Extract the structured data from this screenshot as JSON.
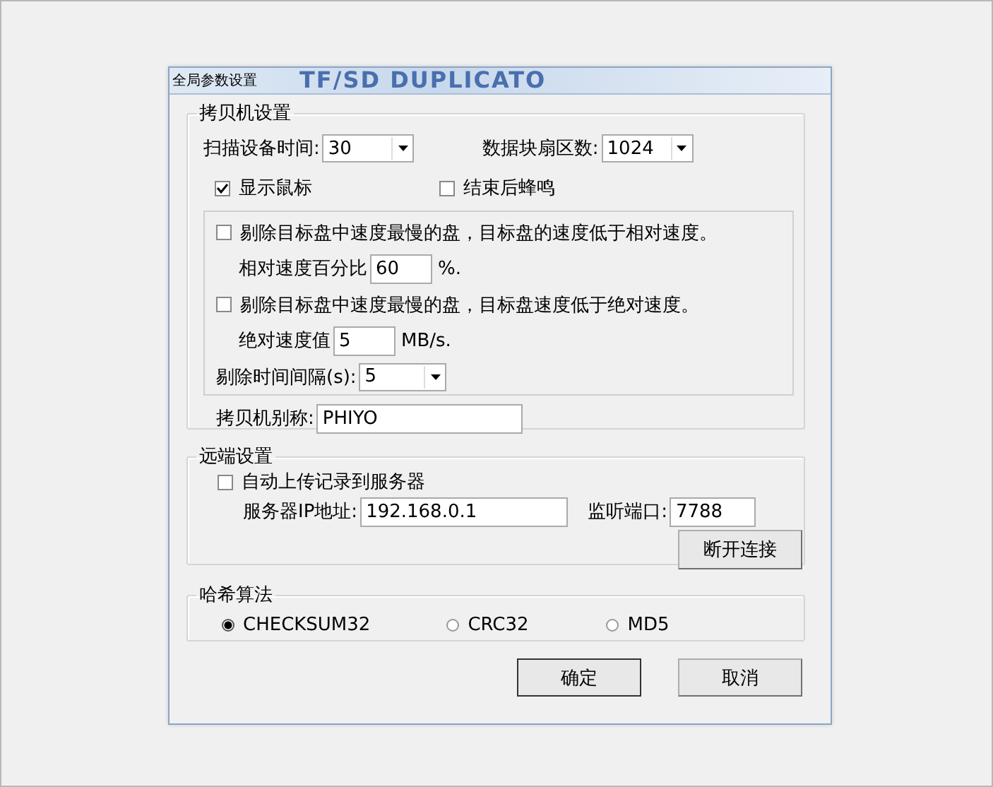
{
  "window": {
    "title": "全局参数设置",
    "banner": "TF/SD DUPLICATO"
  },
  "copier": {
    "title": "拷贝机设置",
    "combos": [
      {
        "label": "扫描设备时间:",
        "value": "30"
      },
      {
        "label": "数据块扇区数:",
        "value": "1024"
      }
    ],
    "checks": [
      {
        "label": "显示鼠标",
        "checked": true
      },
      {
        "label": "结束后蜂鸣",
        "checked": false
      }
    ],
    "rules": [
      {
        "label": "剔除目标盘中速度最慢的盘，目标盘的速度低于相对速度。",
        "checked": false,
        "field_label": "相对速度百分比",
        "value": "60",
        "unit": "%."
      },
      {
        "label": "剔除目标盘中速度最慢的盘，目标盘速度低于绝对速度。",
        "checked": false,
        "field_label": "绝对速度值",
        "value": "5",
        "unit": "MB/s."
      }
    ],
    "interval": {
      "label": "剔除时间间隔(s):",
      "value": "5"
    },
    "alias": {
      "label": "拷贝机别称:",
      "value": "PHIYO"
    }
  },
  "remote": {
    "title": "远端设置",
    "auto_upload": {
      "label": "自动上传记录到服务器",
      "checked": false
    },
    "ip": {
      "label": "服务器IP地址:",
      "value": "192.168.0.1"
    },
    "port": {
      "label": "监听端口:",
      "value": "7788"
    },
    "disconnect": "断开连接"
  },
  "hash": {
    "title": "哈希算法",
    "options": [
      {
        "label": "CHECKSUM32",
        "selected": true
      },
      {
        "label": "CRC32",
        "selected": false
      },
      {
        "label": "MD5",
        "selected": false
      }
    ]
  },
  "buttons": [
    "确定",
    "取消"
  ]
}
